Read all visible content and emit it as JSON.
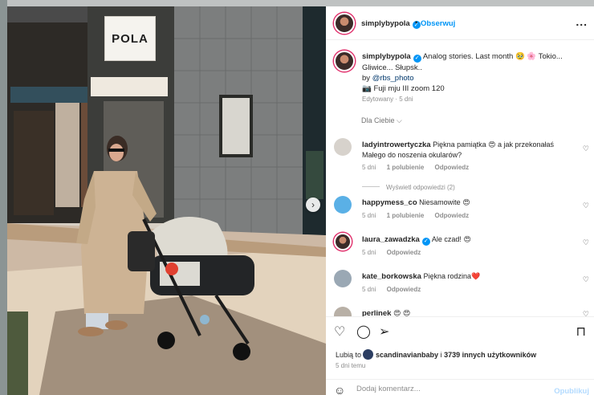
{
  "post": {
    "author": "simplybypola",
    "follow_label": "Obserwuj",
    "more_label": "...",
    "sign_text": "POLA",
    "next_arrow": "›",
    "caption": {
      "author": "simplybypola",
      "text_main": "Analog stories. Last month 🥹 🌸 Tokio... Gliwice... Słupsk..",
      "by_label": "by",
      "photo_credit": "@rbs_photo",
      "camera_line": "📷 Fuji mju III zoom 120",
      "edited": "Edytowany · 5 dni"
    },
    "filter_label": "Dla Ciebie ⌵"
  },
  "comments": [
    {
      "user": "ladyintrowertyczka",
      "text": "Piękna pamiątka 😍 a jak przekonałaś Małego do noszenia okularów?",
      "time": "5 dni",
      "likes": "1 polubienie",
      "reply": "Odpowiedz",
      "view_replies": "Wyświetl odpowiedzi (2)"
    },
    {
      "user": "happymess_co",
      "text": "Niesamowite 😍",
      "time": "5 dni",
      "likes": "1 polubienie",
      "reply": "Odpowiedz"
    },
    {
      "user": "laura_zawadzka",
      "text": "Ale czad! 😍",
      "time": "5 dni",
      "reply": "Odpowiedz"
    },
    {
      "user": "kate_borkowska",
      "text": "Piękna rodzina❤️",
      "time": "5 dni",
      "reply": "Odpowiedz"
    },
    {
      "user": "perlinek",
      "text": "😍 😍"
    }
  ],
  "actions": {
    "like_icon": "♡",
    "comment_icon": "◯",
    "share_icon": "➢",
    "save_icon": "⊓",
    "likes_prefix": "Lubią to",
    "likes_user": "scandinavianbaby",
    "likes_and": "i",
    "likes_count": "3739 innych użytkowników",
    "time_ago": "5 dni temu"
  },
  "composer": {
    "emoji_icon": "☺",
    "placeholder": "Dodaj komentarz...",
    "publish_label": "Opublikuj"
  },
  "colors": {
    "accent": "#0095f6",
    "muted": "#8e8e8e"
  }
}
